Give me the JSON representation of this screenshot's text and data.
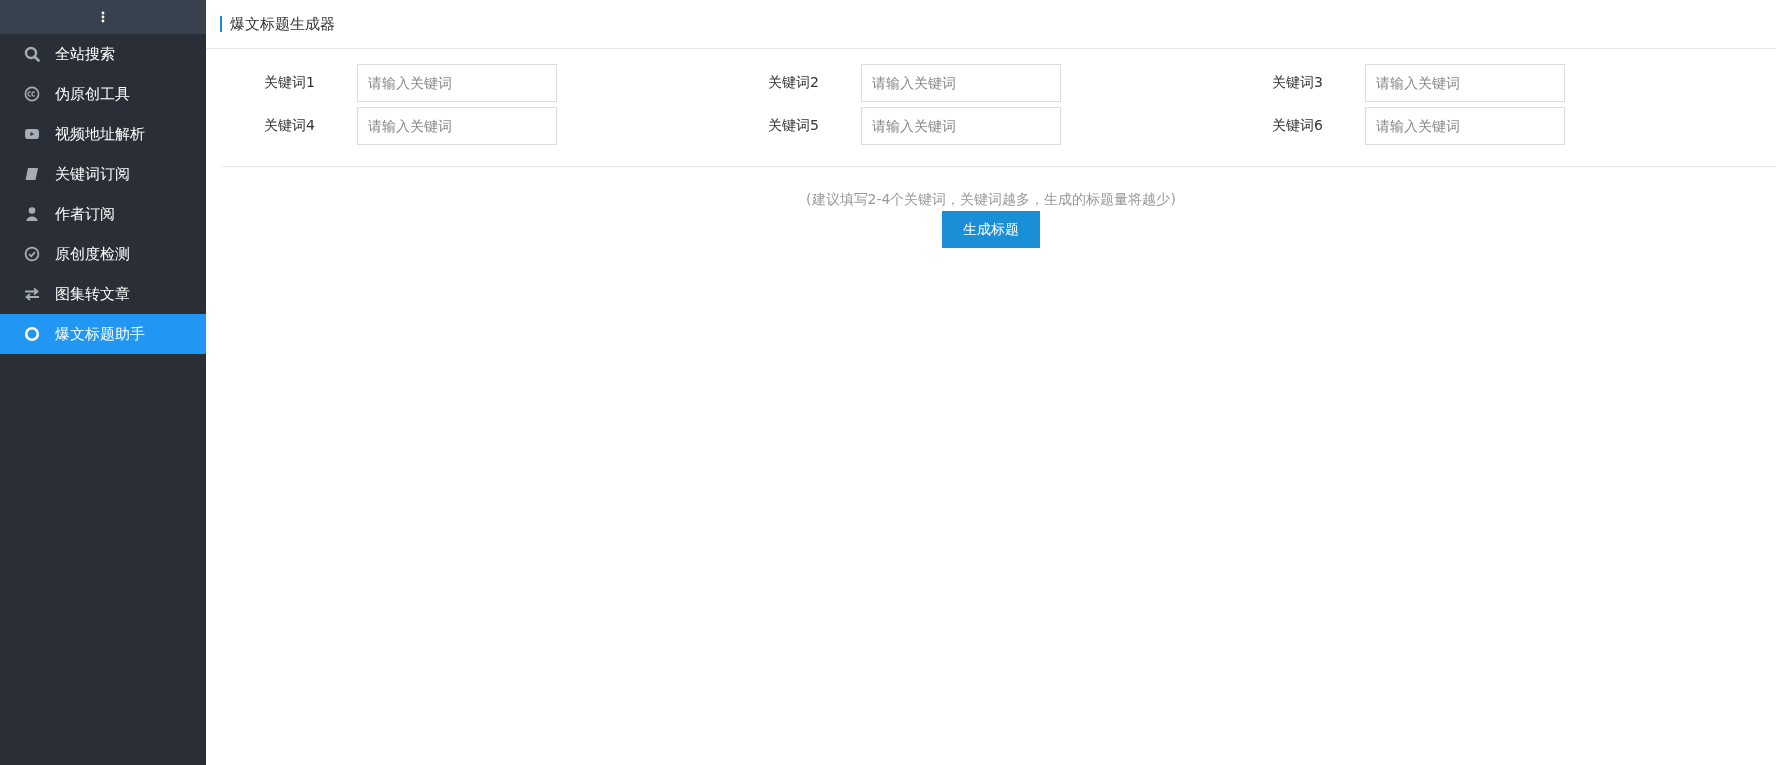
{
  "sidebar": {
    "items": [
      {
        "label": "全站搜索",
        "selected": false
      },
      {
        "label": "伪原创工具",
        "selected": false
      },
      {
        "label": "视频地址解析",
        "selected": false
      },
      {
        "label": "关键词订阅",
        "selected": false
      },
      {
        "label": "作者订阅",
        "selected": false
      },
      {
        "label": "原创度检测",
        "selected": false
      },
      {
        "label": "图集转文章",
        "selected": false
      },
      {
        "label": "爆文标题助手",
        "selected": true
      }
    ]
  },
  "panel": {
    "title": "爆文标题生成器",
    "fields": [
      {
        "label": "关键词1",
        "placeholder": "请输入关键词"
      },
      {
        "label": "关键词2",
        "placeholder": "请输入关键词"
      },
      {
        "label": "关键词3",
        "placeholder": "请输入关键词"
      },
      {
        "label": "关键词4",
        "placeholder": "请输入关键词"
      },
      {
        "label": "关键词5",
        "placeholder": "请输入关键词"
      },
      {
        "label": "关键词6",
        "placeholder": "请输入关键词"
      }
    ],
    "hint": "(建议填写2-4个关键词，关键词越多，生成的标题量将越少)",
    "button": "生成标题"
  }
}
